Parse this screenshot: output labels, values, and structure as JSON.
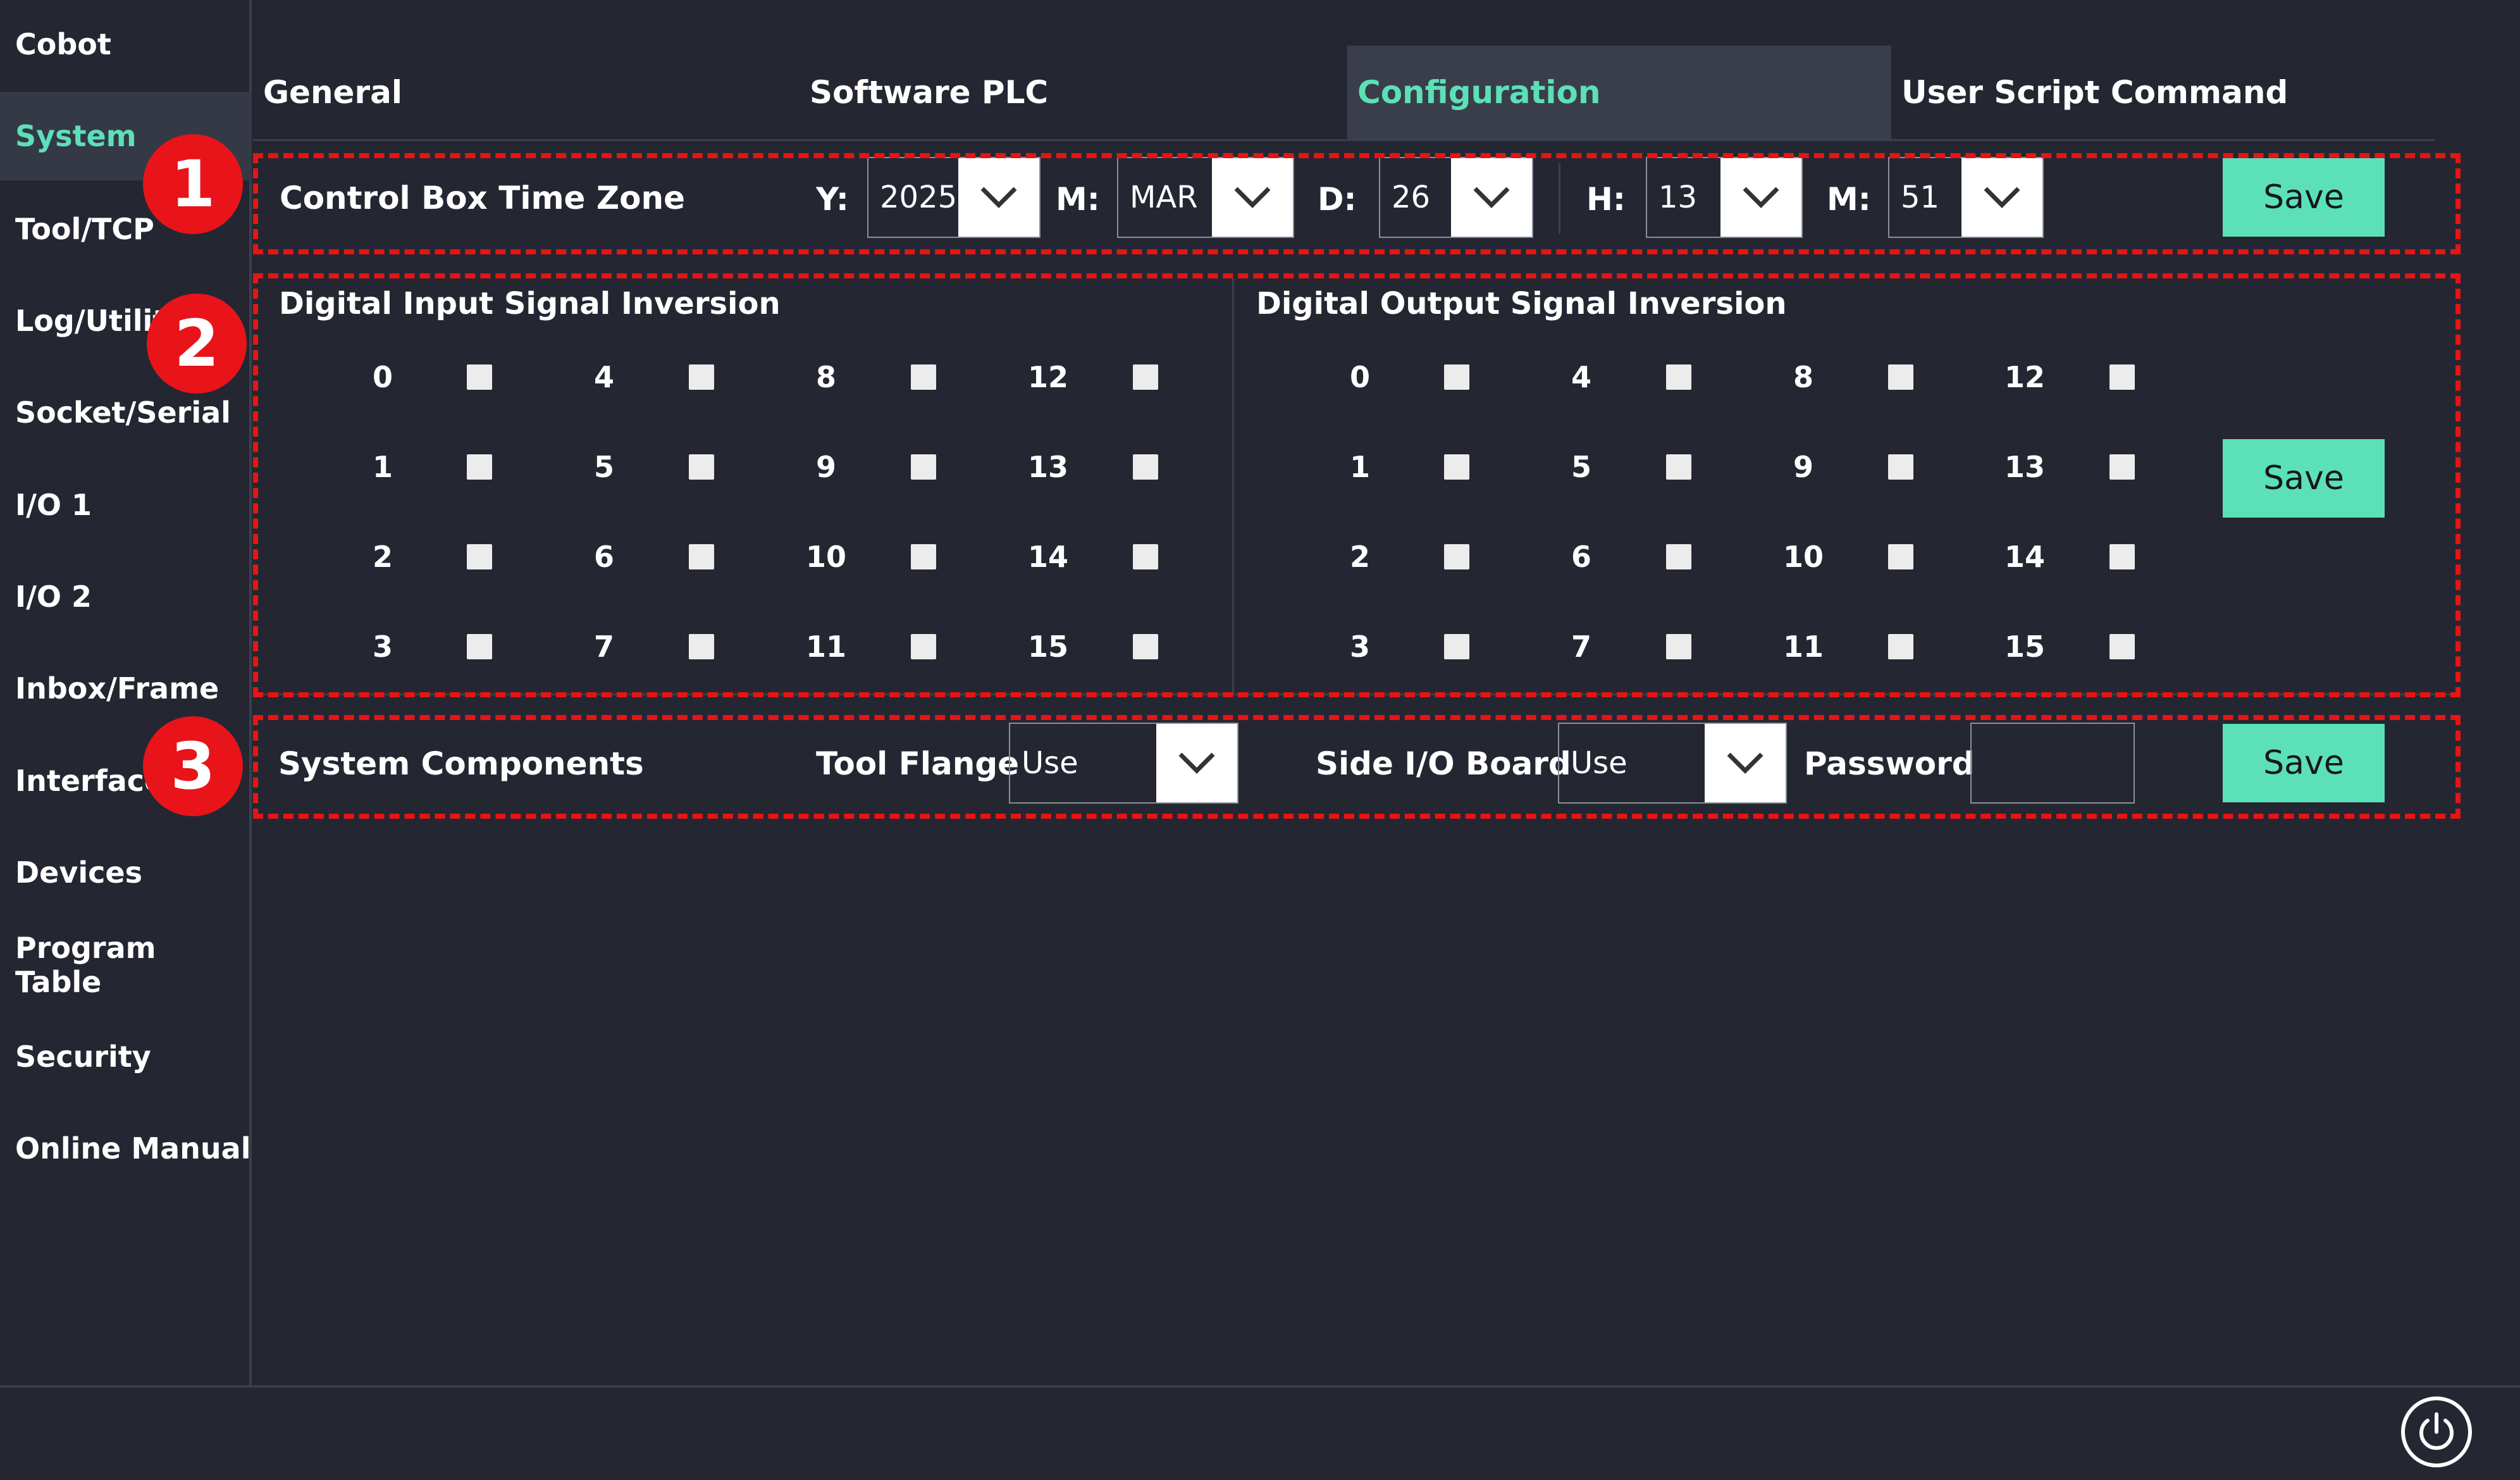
{
  "sidebar": {
    "items": [
      {
        "label": "Cobot"
      },
      {
        "label": "System",
        "active": true
      },
      {
        "label": "Tool/TCP"
      },
      {
        "label": "Log/Utility"
      },
      {
        "label": "Socket/Serial"
      },
      {
        "label": "I/O 1"
      },
      {
        "label": "I/O 2"
      },
      {
        "label": "Inbox/Frame"
      },
      {
        "label": "Interface"
      },
      {
        "label": "Devices"
      },
      {
        "label": "Program Table"
      },
      {
        "label": "Security"
      },
      {
        "label": "Online Manual"
      }
    ]
  },
  "tabs": [
    {
      "label": "General"
    },
    {
      "label": "Software PLC"
    },
    {
      "label": "Configuration",
      "active": true
    },
    {
      "label": "User Script Command"
    }
  ],
  "time_zone": {
    "label": "Control Box Time Zone",
    "year_label": "Y:",
    "year": "2025",
    "month_label": "M:",
    "month": "MAR",
    "day_label": "D:",
    "day": "26",
    "hour_label": "H:",
    "hour": "13",
    "minute_label": "M:",
    "minute": "51",
    "save_label": "Save"
  },
  "signal_inversion": {
    "input_title": "Digital Input Signal Inversion",
    "output_title": "Digital Output Signal Inversion",
    "channels": [
      "0",
      "1",
      "2",
      "3",
      "4",
      "5",
      "6",
      "7",
      "8",
      "9",
      "10",
      "11",
      "12",
      "13",
      "14",
      "15"
    ],
    "save_label": "Save"
  },
  "system_components": {
    "label": "System Components",
    "tool_flange_label": "Tool Flange",
    "tool_flange_value": "Use",
    "side_io_label": "Side I/O Board",
    "side_io_value": "Use",
    "password_label": "Password",
    "password_value": "",
    "save_label": "Save"
  },
  "annotations": {
    "marker1": "1",
    "marker2": "2",
    "marker3": "3",
    "color": "#e81414"
  },
  "colors": {
    "background": "#242732",
    "accent": "#5ce0b8",
    "active_tab_bg": "#3a3e4b"
  },
  "icons": {
    "dropdown": "chevron-down-icon",
    "power": "power-icon"
  }
}
